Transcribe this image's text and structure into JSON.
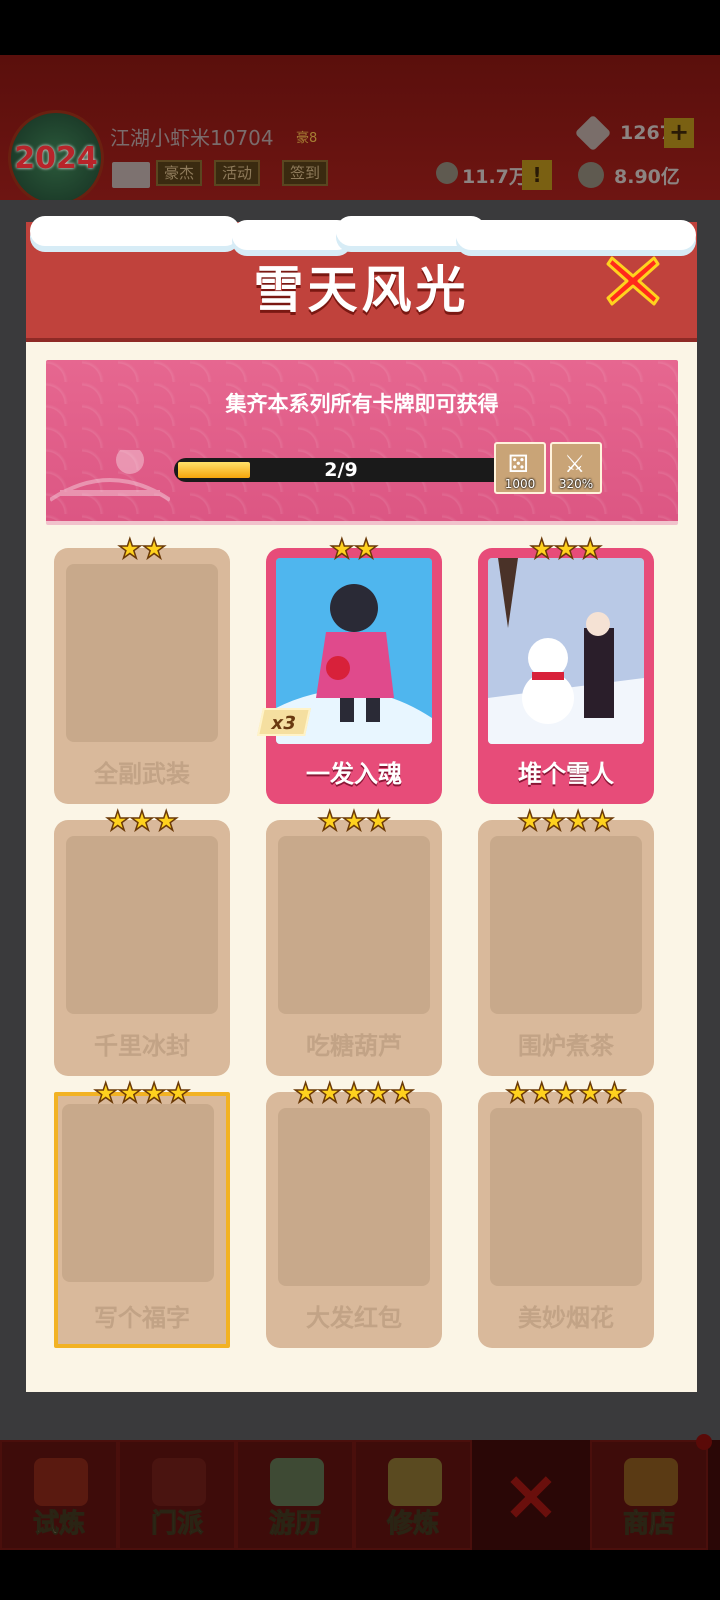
{
  "header": {
    "emblem_text": "2024",
    "player_name": "江湖小虾米10704",
    "player_rank": "豪8",
    "buttons": [
      "豪杰",
      "活动",
      "签到"
    ],
    "gems": "1267",
    "plus": "+",
    "currency_a": "11.7万",
    "alert": "!",
    "coins": "8.90亿"
  },
  "modal": {
    "title": "雪天风光",
    "banner_text": "集齐本系列所有卡牌即可获得",
    "progress_text": "2/9",
    "progress_fraction": 0.2222,
    "rewards": [
      {
        "icon": "dice-icon",
        "value": "1000"
      },
      {
        "icon": "sword-icon",
        "value": "320%"
      }
    ]
  },
  "cards": [
    {
      "name": "全副武装",
      "stars": 2,
      "owned": false
    },
    {
      "name": "一发入魂",
      "stars": 2,
      "owned": true,
      "count": "x3"
    },
    {
      "name": "堆个雪人",
      "stars": 3,
      "owned": true
    },
    {
      "name": "千里冰封",
      "stars": 3,
      "owned": false
    },
    {
      "name": "吃糖葫芦",
      "stars": 3,
      "owned": false
    },
    {
      "name": "围炉煮茶",
      "stars": 4,
      "owned": false
    },
    {
      "name": "写个福字",
      "stars": 4,
      "owned": false,
      "gold": true
    },
    {
      "name": "大发红包",
      "stars": 5,
      "owned": false
    },
    {
      "name": "美妙烟花",
      "stars": 5,
      "owned": false
    }
  ],
  "nav": {
    "items": [
      "试炼",
      "门派",
      "游历",
      "修炼",
      "×",
      "商店"
    ]
  },
  "colors": {
    "modal_header": "#c0423c",
    "banner_pink": "#e0608a",
    "card_owned": "#e74c79",
    "card_locked": "#d9b99b",
    "star": "#ffd21e"
  }
}
